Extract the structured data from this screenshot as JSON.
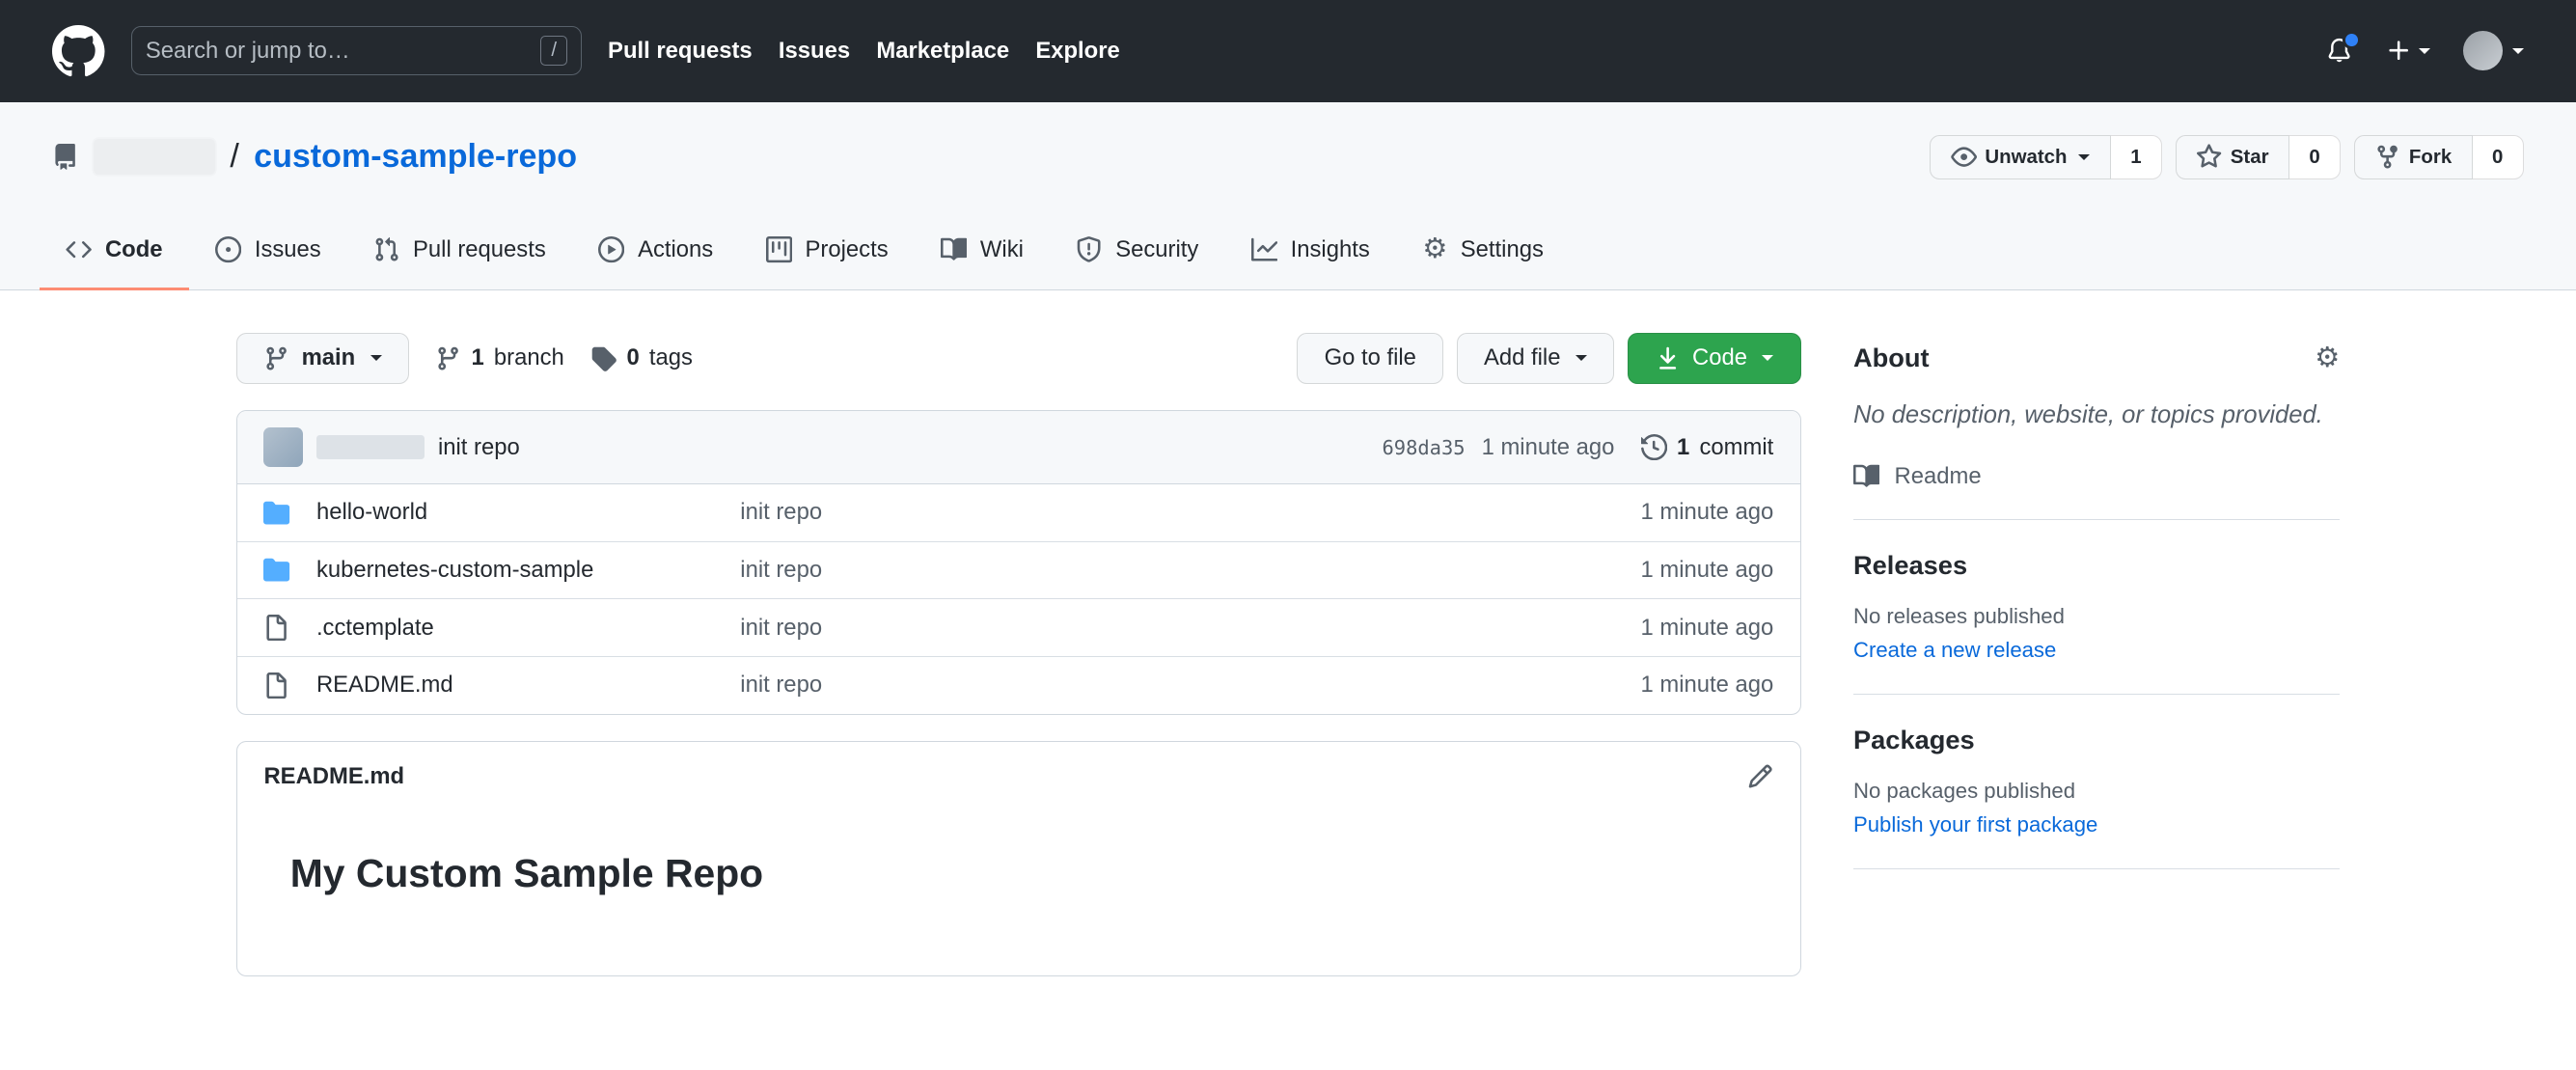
{
  "colors": {
    "header_bg": "#24292f",
    "accent_link": "#0969da",
    "green_button": "#2da44e",
    "tab_underline": "#fd8c73",
    "notification_dot": "#2f81f7",
    "folder_icon": "#54aeff"
  },
  "header": {
    "search": {
      "placeholder": "Search or jump to…",
      "shortcut": "/"
    },
    "nav": [
      {
        "label": "Pull requests"
      },
      {
        "label": "Issues"
      },
      {
        "label": "Marketplace"
      },
      {
        "label": "Explore"
      }
    ]
  },
  "repo": {
    "separator": "/",
    "name": "custom-sample-repo",
    "actions": {
      "unwatch_label": "Unwatch",
      "unwatch_count": "1",
      "star_label": "Star",
      "star_count": "0",
      "fork_label": "Fork",
      "fork_count": "0"
    }
  },
  "tabs": [
    {
      "label": "Code"
    },
    {
      "label": "Issues"
    },
    {
      "label": "Pull requests"
    },
    {
      "label": "Actions"
    },
    {
      "label": "Projects"
    },
    {
      "label": "Wiki"
    },
    {
      "label": "Security"
    },
    {
      "label": "Insights"
    },
    {
      "label": "Settings"
    }
  ],
  "file_nav": {
    "branch": "main",
    "branch_count": "1",
    "branch_label": "branch",
    "tag_count": "0",
    "tag_label": "tags",
    "go_to_file": "Go to file",
    "add_file": "Add file",
    "code": "Code"
  },
  "commit": {
    "message": "init repo",
    "hash": "698da35",
    "time": "1 minute ago",
    "count": "1",
    "count_label": "commit"
  },
  "files": [
    {
      "name": "hello-world",
      "message": "init repo",
      "time": "1 minute ago"
    },
    {
      "name": "kubernetes-custom-sample",
      "message": "init repo",
      "time": "1 minute ago"
    },
    {
      "name": ".cctemplate",
      "message": "init repo",
      "time": "1 minute ago"
    },
    {
      "name": "README.md",
      "message": "init repo",
      "time": "1 minute ago"
    }
  ],
  "readme": {
    "filename": "README.md",
    "heading": "My Custom Sample Repo"
  },
  "sidebar": {
    "about_title": "About",
    "about_description": "No description, website, or topics provided.",
    "readme_link": "Readme",
    "releases_title": "Releases",
    "releases_empty": "No releases published",
    "releases_link": "Create a new release",
    "packages_title": "Packages",
    "packages_empty": "No packages published",
    "packages_link": "Publish your first package"
  }
}
